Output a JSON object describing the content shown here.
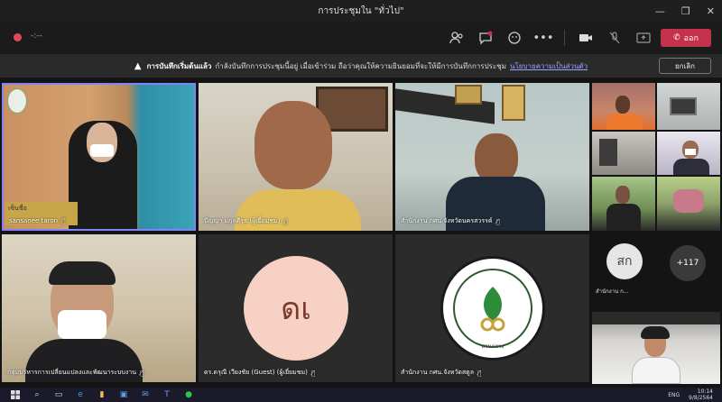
{
  "window": {
    "title": "การประชุมใน \"ทั่วไป\""
  },
  "toolbar": {
    "record_time": "-:--",
    "leave_label": "ออก"
  },
  "banner": {
    "bold_text": "การบันทึกเริ่มต้นแล้ว",
    "text": "กำลังบันทึกการประชุมนี้อยู่ เมื่อเข้าร่วม ถือว่าคุณให้ความยินยอมที่จะให้มีการบันทึกการประชุม",
    "link_text": "นโยบายความเป็นส่วนตัว",
    "dismiss_label": "ยกเลิก"
  },
  "participants": {
    "p1": {
      "name": "sansanee taron",
      "sign": "เซ็นชื่อ"
    },
    "p2": {
      "name": "ปัญญา มกุลศีรุธ (ผู้เยี่ยมชม)"
    },
    "p3": {
      "name": "สำนักงาน กศน.จังหวัดนครสวรรค์"
    },
    "p4": {
      "name": "กลุ่มบริหารการเปลี่ยนแปลงและพัฒนาระบบงาน"
    },
    "p5": {
      "name": "ดร.ดรุณี เวียงชัย (Guest) (ผู้เยี่ยมชม)",
      "initials": "ดเ"
    },
    "p6": {
      "name": "สำนักงาน กศน.จังหวัดสตูล",
      "logo_caption": "สวนกลาง"
    },
    "p7": {
      "name": "สำนักงาน ก...",
      "initials": "สก"
    },
    "overflow": {
      "count": "+117"
    }
  },
  "taskbar": {
    "lang": "ENG",
    "time": "10:14",
    "date": "9/8/2564"
  },
  "colors": {
    "leave": "#c4314b",
    "avatar_dn": "#f6d1c4",
    "avatar_sk": "#e6e6e6"
  }
}
